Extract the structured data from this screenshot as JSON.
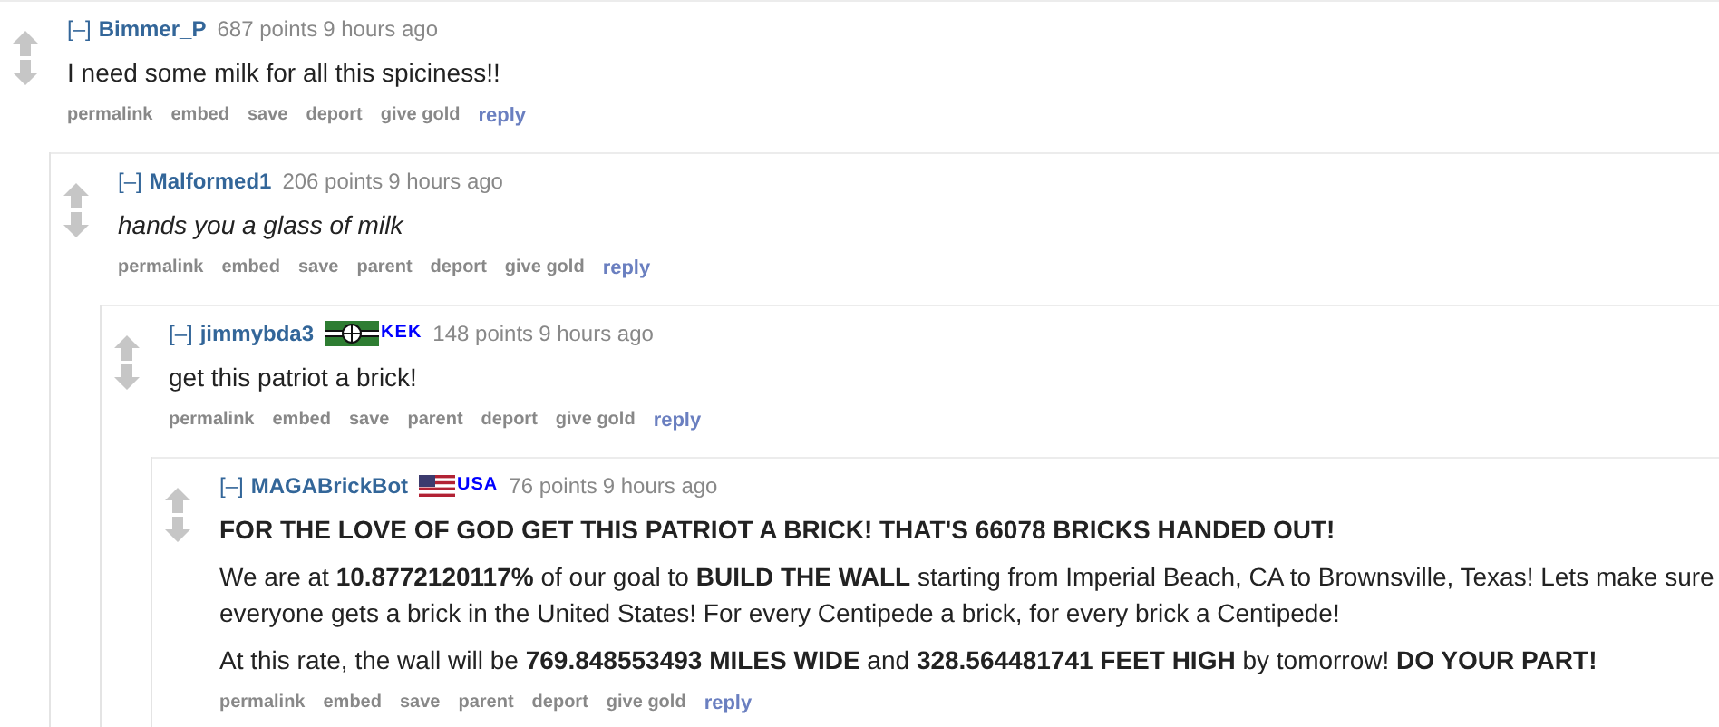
{
  "comments": [
    {
      "toggle": "[–]",
      "author": "Bimmer_P",
      "score": "687 points",
      "time": "9 hours ago",
      "body": [
        {
          "kind": "plain",
          "text": "I need some milk for all this spiciness!!"
        }
      ],
      "actions": [
        "permalink",
        "embed",
        "save",
        "deport",
        "give gold",
        "reply"
      ],
      "children": [
        {
          "toggle": "[–]",
          "author": "Malformed1",
          "score": "206 points",
          "time": "9 hours ago",
          "body": [
            {
              "kind": "italic",
              "text": "hands you a glass of milk"
            }
          ],
          "actions": [
            "permalink",
            "embed",
            "save",
            "parent",
            "deport",
            "give gold",
            "reply"
          ],
          "children": [
            {
              "toggle": "[–]",
              "author": "jimmybda3",
              "flair": {
                "kind": "kek",
                "text": "KEK"
              },
              "score": "148 points",
              "time": "9 hours ago",
              "body": [
                {
                  "kind": "plain",
                  "text": "get this patriot a brick!"
                }
              ],
              "actions": [
                "permalink",
                "embed",
                "save",
                "parent",
                "deport",
                "give gold",
                "reply"
              ],
              "children": [
                {
                  "toggle": "[–]",
                  "author": "MAGABrickBot",
                  "flair": {
                    "kind": "usa",
                    "text": "USA"
                  },
                  "score": "76 points",
                  "time": "9 hours ago",
                  "body": [
                    {
                      "kind": "bold",
                      "text": "FOR THE LOVE OF GOD GET THIS PATRIOT A BRICK! THAT'S 66078 BRICKS HANDED OUT!"
                    },
                    {
                      "kind": "plain",
                      "text": "We are at **10.8772120117%** of our goal to **BUILD THE WALL** starting from Imperial Beach, CA to Brownsville, Texas! Lets make sure everyone gets a brick in the United States! For every Centipede a brick, for every brick a Centipede!"
                    },
                    {
                      "kind": "plain",
                      "text": "At this rate, the wall will be **769.848553493 MILES WIDE** and **328.564481741 FEET HIGH** by tomorrow! **DO YOUR PART!**"
                    }
                  ],
                  "actions": [
                    "permalink",
                    "embed",
                    "save",
                    "parent",
                    "deport",
                    "give gold",
                    "reply"
                  ]
                }
              ]
            }
          ]
        }
      ]
    }
  ]
}
